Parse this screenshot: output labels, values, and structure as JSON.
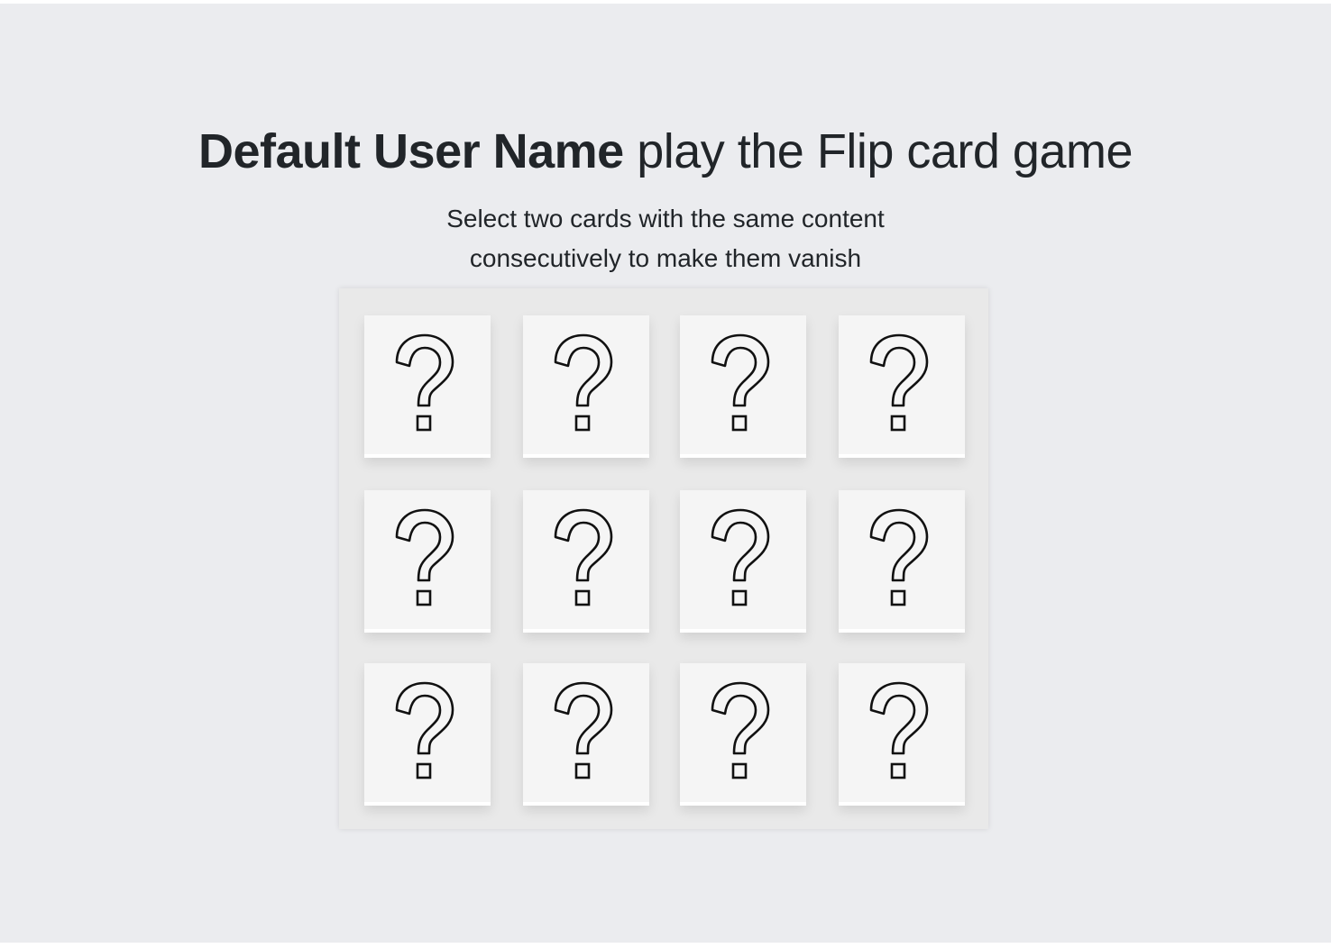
{
  "header": {
    "username": "Default User Name",
    "title_rest": " play the Flip card game",
    "instructions_line1": "Select two cards with the same content",
    "instructions_line2": "consecutively to make them vanish"
  },
  "board": {
    "rows": 3,
    "columns": 4,
    "cards": [
      {
        "face": "question-mark",
        "flipped": false
      },
      {
        "face": "question-mark",
        "flipped": false
      },
      {
        "face": "question-mark",
        "flipped": false
      },
      {
        "face": "question-mark",
        "flipped": false
      },
      {
        "face": "question-mark",
        "flipped": false
      },
      {
        "face": "question-mark",
        "flipped": false
      },
      {
        "face": "question-mark",
        "flipped": false
      },
      {
        "face": "question-mark",
        "flipped": false
      },
      {
        "face": "question-mark",
        "flipped": false
      },
      {
        "face": "question-mark",
        "flipped": false
      },
      {
        "face": "question-mark",
        "flipped": false
      },
      {
        "face": "question-mark",
        "flipped": false
      }
    ]
  },
  "colors": {
    "page_background": "#ebecef",
    "board_background": "#e9e9e9",
    "card_background": "#f5f5f5",
    "text": "#212529"
  }
}
